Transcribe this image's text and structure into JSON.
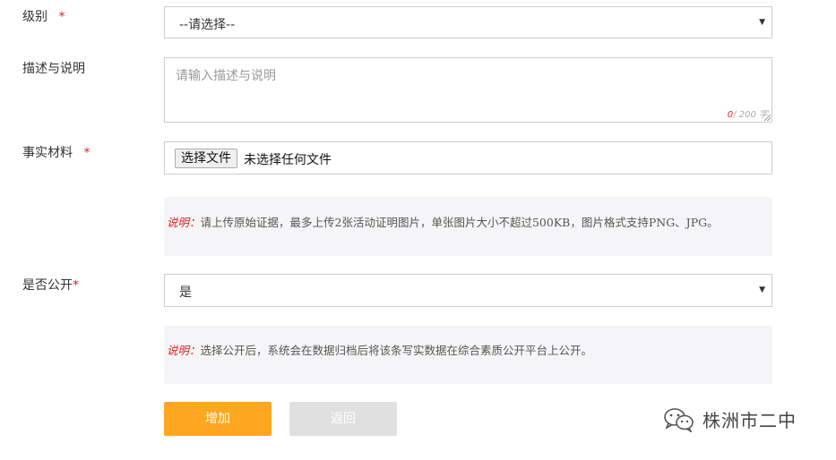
{
  "form": {
    "level": {
      "label": "级别",
      "required_mark": "*",
      "value": "--请选择--"
    },
    "description": {
      "label": "描述与说明",
      "placeholder": "请输入描述与说明",
      "counter_current": "0",
      "counter_max": "/ 200 字"
    },
    "materials": {
      "label": "事实材料",
      "required_mark": "*",
      "file_button": "选择文件",
      "file_status": "未选择任何文件"
    },
    "materials_note": {
      "tag": "说明：",
      "text": "请上传原始证据，最多上传2张活动证明图片，单张图片大小不超过500KB，图片格式支持PNG、JPG。"
    },
    "public": {
      "label": "是否公开",
      "required_mark": "*",
      "value": "是"
    },
    "public_note": {
      "tag": "说明：",
      "text": "选择公开后，系统会在数据归档后将该条写实数据在综合素质公开平台上公开。"
    }
  },
  "actions": {
    "add_label": "增加",
    "back_label": "返回"
  },
  "watermark": {
    "text": "株洲市二中",
    "icon": "wechat-icon"
  },
  "colors": {
    "required": "#e02020",
    "primary_button": "#ffa620",
    "disabled_button": "#e0e0e0",
    "note_bg": "#f5f5f7"
  }
}
